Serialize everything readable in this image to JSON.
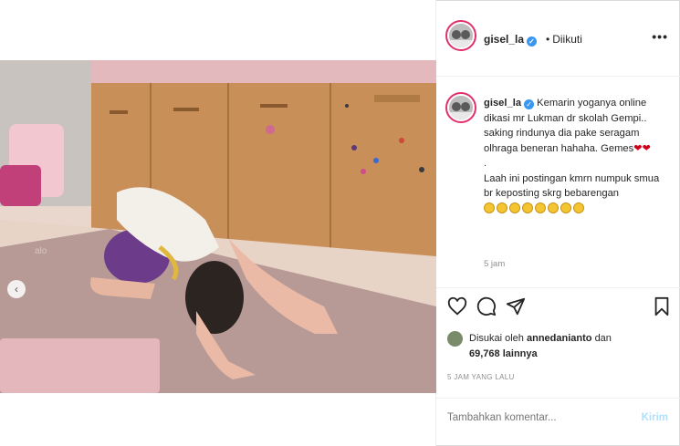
{
  "post": {
    "username": "gisel_la",
    "verified": true,
    "follow_status": "Diikuti",
    "more_icon": "more-horizontal-icon"
  },
  "caption": {
    "username": "gisel_la",
    "lines": [
      "Kemarin yoganya online dikasi mr Lukman dr skolah Gempi.. saking rindunya dia pake seragam olhraga beneran hahaha. Gemes",
      ".",
      "Laah ini postingan kmrn numpuk smua br keposting skrg bebarengan"
    ],
    "emoji_hearts": "❤❤",
    "emoji_count": 8,
    "time": "5 jam"
  },
  "actions": {
    "icons": [
      "heart-icon",
      "comment-icon",
      "share-icon",
      "bookmark-icon"
    ]
  },
  "likes": {
    "prefix": "Disukai oleh",
    "user": "annedanianto",
    "joiner": "dan",
    "count": "69,768",
    "suffix": "lainnya"
  },
  "timestamp": "5 JAM YANG LALU",
  "comment_box": {
    "placeholder": "Tambahkan komentar...",
    "post_label": "Kirim"
  },
  "carousel": {
    "dots": 3,
    "active_index": 1
  },
  "colors": {
    "accent": "#3897f0",
    "post_disabled": "#b2dffc",
    "heart": "#d0021b"
  }
}
